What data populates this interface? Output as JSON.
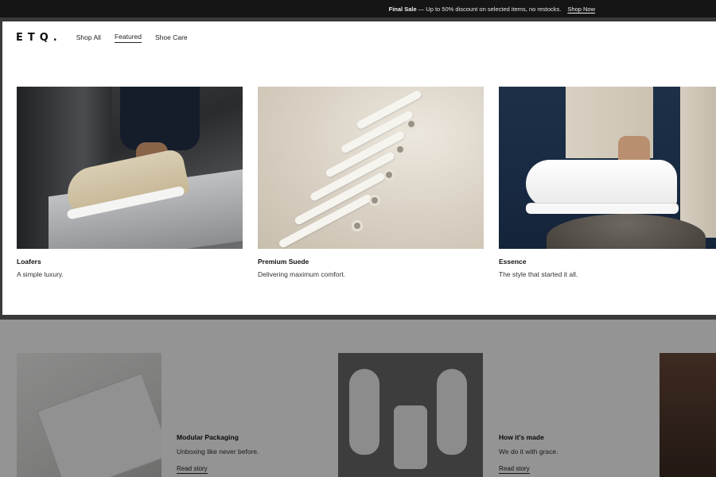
{
  "announcement": {
    "bold_text": "Final Sale",
    "text": "— Up to 50% discount on selected items, no restocks.",
    "link": "Shop Now"
  },
  "header": {
    "logo": "ETQ.",
    "nav": [
      {
        "label": "Shop All",
        "active": false
      },
      {
        "label": "Featured",
        "active": true
      },
      {
        "label": "Shoe Care",
        "active": false
      }
    ]
  },
  "featured": [
    {
      "title": "Loafers",
      "subtitle": "A simple luxury."
    },
    {
      "title": "Premium Suede",
      "subtitle": "Delivering maximum comfort."
    },
    {
      "title": "Essence",
      "subtitle": "The style that started it all."
    }
  ],
  "stories": [
    {
      "title": "Modular Packaging",
      "subtitle": "Unboxing like never before.",
      "link": "Read story"
    },
    {
      "title": "How it's made",
      "subtitle": "We do it with grace.",
      "link": "Read story"
    }
  ],
  "colors": {
    "announcement_bg": "#151515",
    "overlay": "rgba(0,0,0,0.42)",
    "text": "#1a1a1a"
  }
}
